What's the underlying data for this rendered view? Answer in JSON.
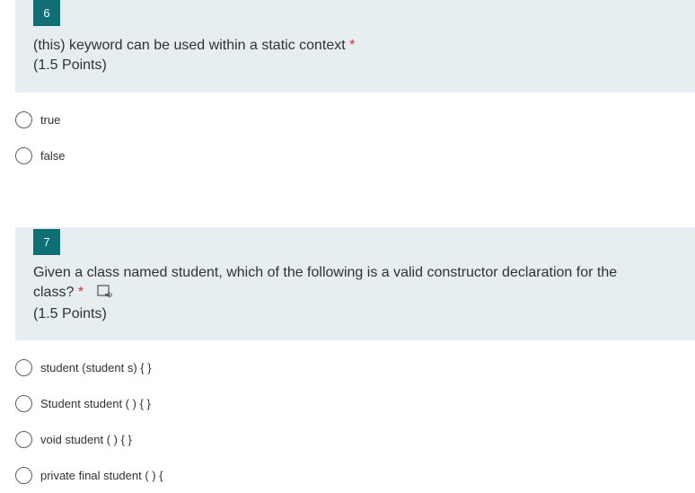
{
  "questions": [
    {
      "number": "6",
      "text": "(this) keyword can be used  within a static context",
      "required_mark": "*",
      "points": "(1.5 Points)",
      "options": [
        "true",
        "false"
      ]
    },
    {
      "number": "7",
      "text_line1": "Given a class named student, which of the following is a valid constructor declaration for the",
      "text_line2": "class?",
      "required_mark": "*",
      "points": "(1.5 Points)",
      "options": [
        "student (student s) { }",
        "Student student ( ) { }",
        "void student ( ) { }",
        "private final student ( ) {"
      ]
    }
  ],
  "colors": {
    "accent": "#0f6f75",
    "header_bg": "#e6eef1",
    "required": "#d13438"
  },
  "icons": {
    "read_aloud": "immersive-reader-icon"
  }
}
